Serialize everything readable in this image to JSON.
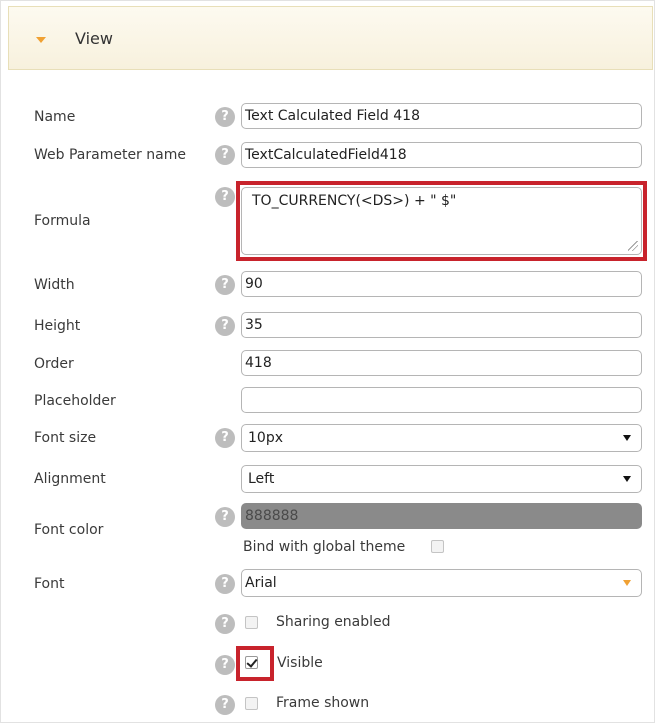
{
  "panel": {
    "title": "View"
  },
  "fields": {
    "name": {
      "label": "Name",
      "value": "Text Calculated Field 418"
    },
    "web_param": {
      "label": "Web Parameter name",
      "value": "TextCalculatedField418"
    },
    "formula": {
      "label": "Formula",
      "value": "TO_CURRENCY(<DS>) + \" $\""
    },
    "width": {
      "label": "Width",
      "value": "90"
    },
    "height": {
      "label": "Height",
      "value": "35"
    },
    "order": {
      "label": "Order",
      "value": "418"
    },
    "placeholder": {
      "label": "Placeholder",
      "value": ""
    },
    "font_size": {
      "label": "Font size",
      "value": "10px"
    },
    "alignment": {
      "label": "Alignment",
      "value": "Left"
    },
    "font_color": {
      "label": "Font color",
      "value": "888888",
      "swatch": "#8a8a8a",
      "bind_label": "Bind with global theme",
      "bind_checked": false
    },
    "font": {
      "label": "Font",
      "value": "Arial"
    }
  },
  "checkboxes": {
    "sharing": {
      "label": "Sharing enabled",
      "checked": false
    },
    "visible": {
      "label": "Visible",
      "checked": true
    },
    "frame": {
      "label": "Frame shown",
      "checked": false
    }
  },
  "help_glyph": "?",
  "colors": {
    "accent": "#f0a133",
    "highlight": "#c8232c"
  }
}
